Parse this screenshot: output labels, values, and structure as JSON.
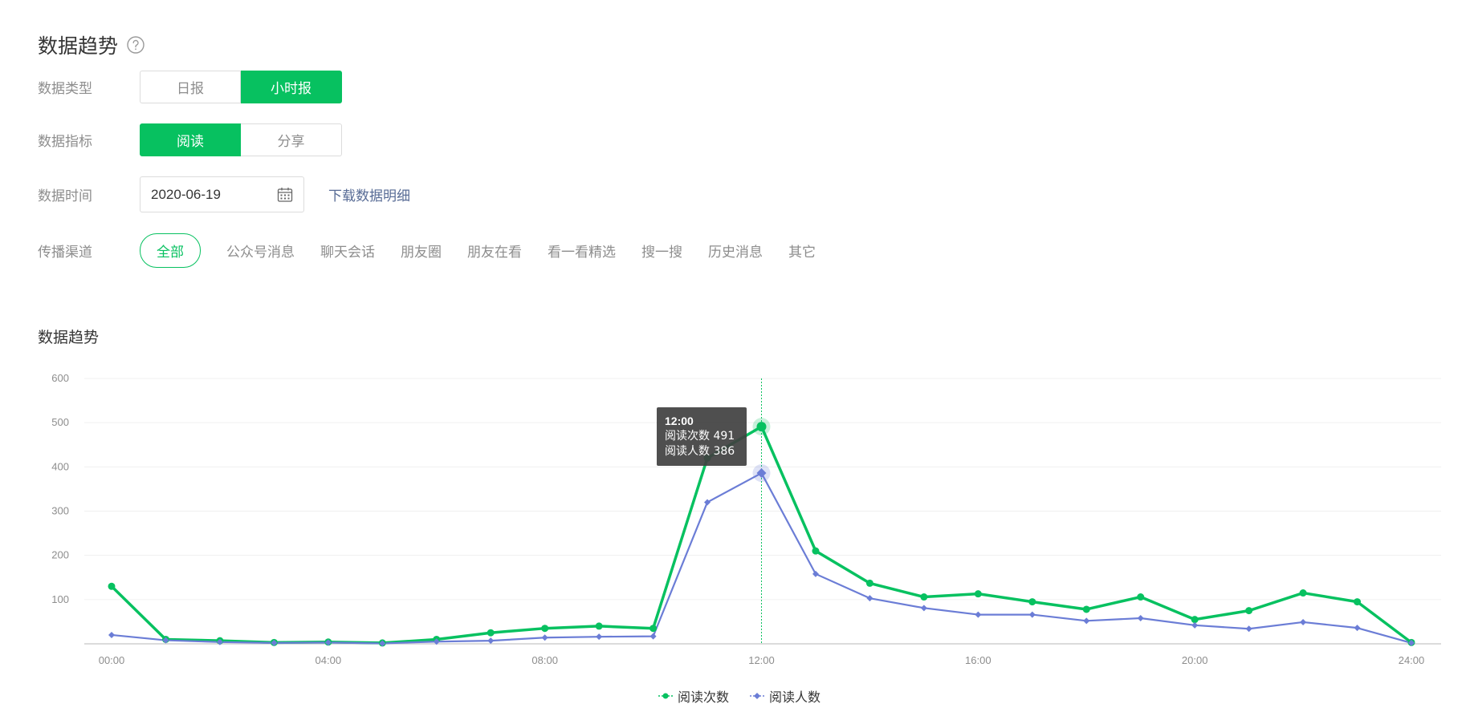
{
  "header": {
    "title": "数据趋势",
    "help_icon": "question-circle-icon"
  },
  "filters": {
    "data_type": {
      "label": "数据类型",
      "options": [
        "日报",
        "小时报"
      ],
      "selected": "小时报"
    },
    "data_metric": {
      "label": "数据指标",
      "options": [
        "阅读",
        "分享"
      ],
      "selected": "阅读"
    },
    "data_time": {
      "label": "数据时间",
      "value": "2020-06-19",
      "calendar_icon": "calendar-icon",
      "download_link": "下载数据明细"
    },
    "channel": {
      "label": "传播渠道",
      "options": [
        "全部",
        "公众号消息",
        "聊天会话",
        "朋友圈",
        "朋友在看",
        "看一看精选",
        "搜一搜",
        "历史消息",
        "其它"
      ],
      "selected": "全部"
    }
  },
  "chart_section": {
    "title": "数据趋势"
  },
  "colors": {
    "accent": "#07c160",
    "series2": "#6b7dd6",
    "link": "#576b95"
  },
  "tooltip": {
    "title": "12:00",
    "line1": "阅读次数 491",
    "line2": "阅读人数 386"
  },
  "chart_data": {
    "type": "line",
    "x": [
      0,
      1,
      2,
      3,
      4,
      5,
      6,
      7,
      8,
      9,
      10,
      11,
      12,
      13,
      14,
      15,
      16,
      17,
      18,
      19,
      20,
      21,
      22,
      23,
      24
    ],
    "xticks": [
      "00:00",
      "04:00",
      "08:00",
      "12:00",
      "16:00",
      "20:00",
      "24:00"
    ],
    "xtick_positions": [
      0,
      4,
      8,
      12,
      16,
      20,
      24
    ],
    "yticks": [
      "100",
      "200",
      "300",
      "400",
      "500",
      "600"
    ],
    "ylim": [
      0,
      600
    ],
    "grid": true,
    "legend_position": "bottom",
    "highlight_x": 12,
    "series": [
      {
        "name": "阅读次数",
        "color": "#07c160",
        "marker": "circle",
        "values": [
          130,
          10,
          7,
          3,
          4,
          2,
          10,
          25,
          35,
          40,
          35,
          420,
          491,
          210,
          137,
          106,
          113,
          95,
          78,
          106,
          55,
          75,
          115,
          95,
          3
        ]
      },
      {
        "name": "阅读人数",
        "color": "#6b7dd6",
        "marker": "diamond",
        "values": [
          20,
          8,
          4,
          2,
          3,
          1,
          5,
          7,
          14,
          16,
          17,
          320,
          386,
          158,
          103,
          81,
          66,
          66,
          52,
          58,
          42,
          34,
          49,
          36,
          2
        ]
      }
    ]
  }
}
